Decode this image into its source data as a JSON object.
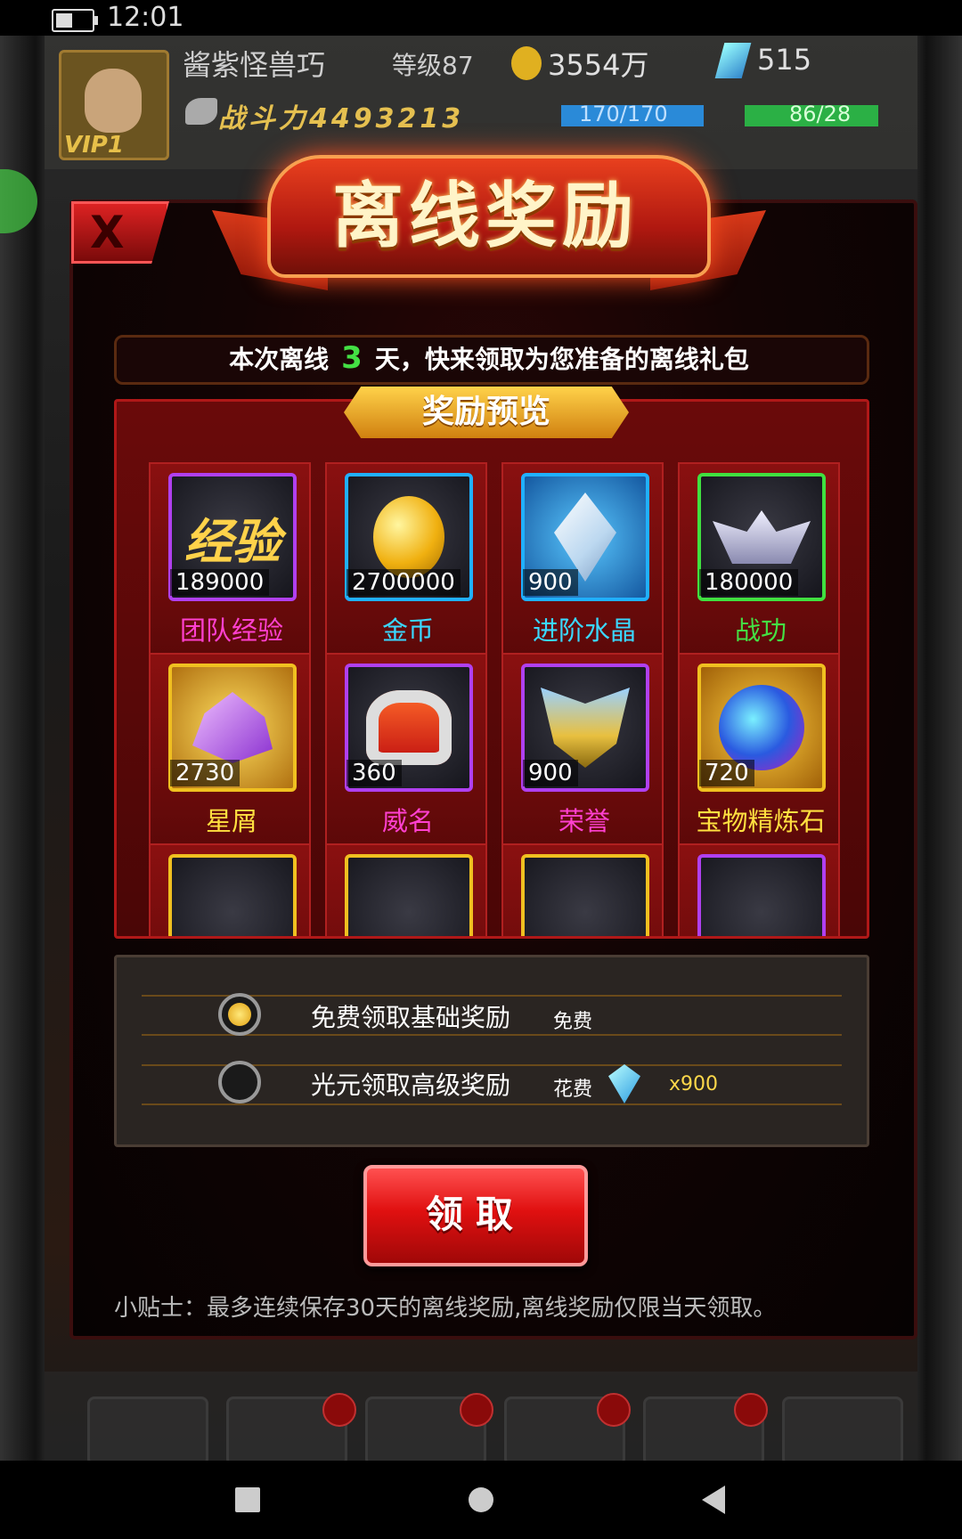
{
  "status_bar": {
    "time": "12:01"
  },
  "player": {
    "name": "酱紫怪兽巧",
    "level": "等级87",
    "gold": "3554万",
    "gems": "515",
    "power": "战斗力4493213",
    "stamina": "170/170",
    "energy": "86/28",
    "vip": "VIP1"
  },
  "modal": {
    "title": "离线奖励",
    "close_label": "X",
    "info_prefix": "本次离线",
    "days": "3",
    "info_suffix": "天，快来领取为您准备的离线礼包",
    "preview_label": "奖励预览",
    "rewards": [
      {
        "name": "团队经验",
        "qty": "189000",
        "icon": "exp-icon"
      },
      {
        "name": "金币",
        "qty": "2700000",
        "icon": "gold-coin-icon"
      },
      {
        "name": "进阶水晶",
        "qty": "900",
        "icon": "crystal-icon"
      },
      {
        "name": "战功",
        "qty": "180000",
        "icon": "medal-icon"
      },
      {
        "name": "星屑",
        "qty": "2730",
        "icon": "stardust-icon"
      },
      {
        "name": "威名",
        "qty": "360",
        "icon": "prestige-icon"
      },
      {
        "name": "荣誉",
        "qty": "900",
        "icon": "honor-icon"
      },
      {
        "name": "宝物精炼石",
        "qty": "720",
        "icon": "refine-stone-icon"
      }
    ],
    "options": [
      {
        "label": "免费领取基础奖励",
        "tag": "免费",
        "selected": true
      },
      {
        "label": "光元领取高级奖励",
        "tag": "花费",
        "cost": "x900",
        "selected": false
      }
    ],
    "claim_label": "领取",
    "tip": "小贴士：最多连续保存30天的离线奖励,离线奖励仅限当天领取。"
  },
  "colors": {
    "exp_name": "#ff40d0",
    "cyan_name": "#3ad8ff",
    "green_name": "#44e044",
    "yellow_name": "#ffe040",
    "purple_name": "#ff40d0",
    "border_purple": "#b040f0",
    "border_blue": "#20b0ff",
    "border_green": "#40e040",
    "border_gold": "#f0c020"
  }
}
